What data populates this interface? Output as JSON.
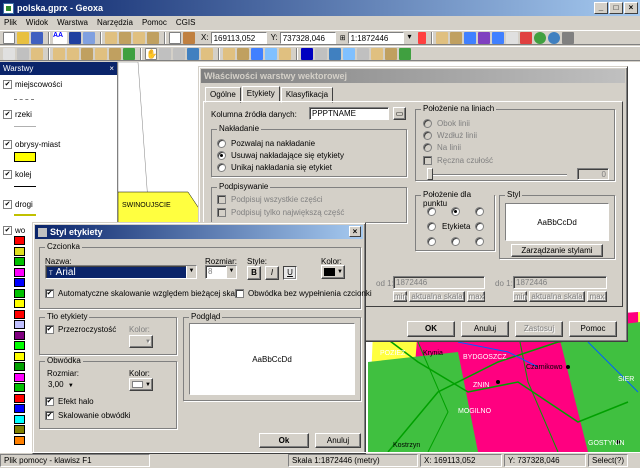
{
  "window": {
    "title": "polska.gprx - Geoxa"
  },
  "menu": [
    "Plik",
    "Widok",
    "Warstwa",
    "Narzędzia",
    "Pomoc",
    "CGIS"
  ],
  "toolbar": {
    "x_label": "X:",
    "x_value": "169113,052",
    "y_label": "Y:",
    "y_value": "737328,046",
    "scale_value": "1:1872446"
  },
  "layers_panel": {
    "title": "Warstwy",
    "layers": [
      {
        "name": "miejscowości",
        "checked": true
      },
      {
        "name": "rzeki",
        "checked": true
      },
      {
        "name": "obrysy-miast",
        "checked": true
      },
      {
        "name": "kolej",
        "checked": true
      },
      {
        "name": "drogi",
        "checked": true
      },
      {
        "name": "wo",
        "checked": true
      }
    ],
    "palette": [
      "#ff0000",
      "#e0e020",
      "#00c000",
      "#ff00ff",
      "#0000ff",
      "#00c000",
      "#ffff00",
      "#ff0000",
      "#c0c0ff",
      "#800080",
      "#00ff00",
      "#ffff00",
      "#00a000",
      "#ff00ff",
      "#00c000",
      "#ff0000",
      "#0000ff",
      "#00ffff",
      "#808000",
      "#ff8000"
    ]
  },
  "map": {
    "labels": {
      "swinoujscie": "SWINOUJSCIE",
      "pozl": "POZIEZ",
      "krynia": "Krynia",
      "bydgoszcz": "BYDGOSZCZ",
      "czarnikowo": "Czarnikowo",
      "znin": "ZNIN",
      "mogilno": "MOGILNO",
      "gostynin": "GOSTYNIN",
      "kostrzyn": "Kostrzyn",
      "sier": "SIER"
    },
    "colors": {
      "region": "#ff0080",
      "land": "#ffff40",
      "green": "#40c040",
      "water": "#00a0ff"
    }
  },
  "props_dialog": {
    "title": "Właściwości warstwy wektorowej",
    "tabs": [
      "Ogólne",
      "Etykiety",
      "Klasyfikacja"
    ],
    "source_column_label": "Kolumna źródła danych:",
    "source_column_value": "PPPTNAME",
    "overlap": {
      "title": "Nakładanie",
      "options": [
        "Pozwalaj na nakładanie",
        "Usuwaj nakładające się etykiety",
        "Unikaj nakładania się etykiet"
      ],
      "selected": 1
    },
    "signing": {
      "title": "Podpisywanie",
      "options": [
        "Podpisuj wszystkie części",
        "Podpisuj tylko największą część"
      ]
    },
    "line_position": {
      "title": "Położenie na liniach",
      "options": [
        "Obok linii",
        "Wzdłuż linii",
        "Na linii"
      ],
      "follow": "Ręczna czułość",
      "slider_value": "0"
    },
    "point_position": {
      "title": "Położenie dla punktu",
      "center_label": "Etykieta"
    },
    "style": {
      "title": "Styl",
      "preview": "AaBbCcDd",
      "manage_button": "Zarządzanie stylami"
    },
    "scale_left": {
      "label": "od 1:",
      "value": "1872446",
      "buttons": [
        "min",
        "aktualna skala",
        "max"
      ]
    },
    "scale_right": {
      "label": "do 1:",
      "value": "1872446",
      "buttons": [
        "min",
        "aktualna skala",
        "max"
      ]
    },
    "buttons": {
      "ok": "OK",
      "cancel": "Anuluj",
      "apply": "Zastosuj",
      "help": "Pomoc"
    }
  },
  "style_dialog": {
    "title": "Styl etykiety",
    "font_group": "Czcionka",
    "name_label": "Nazwa:",
    "font_name": "Arial",
    "size_label": "Rozmiar:",
    "size_value": "8",
    "style_label": "Style:",
    "style_buttons": [
      "B",
      "I",
      "U"
    ],
    "color_label": "Kolor:",
    "color_value": "#000000",
    "auto_scale": "Automatyczne skalowanie względem bieżącej skali",
    "outline_no_fill": "Obwódka bez wypełnienia czcionki",
    "bg_group": "Tło etykiety",
    "transparency": "Przezroczystość",
    "bg_color_label": "Kolor:",
    "preview_group": "Podgląd",
    "preview_text": "AaBbCcDd",
    "outline_group": "Obwódka",
    "outline_size_label": "Rozmiar:",
    "outline_size_value": "3,00",
    "outline_color_label": "Kolor:",
    "halo": "Efekt halo",
    "scale_outline": "Skalowanie obwódki",
    "ok": "Ok",
    "cancel": "Anuluj"
  },
  "status": {
    "help": "Plik pomocy - klawisz F1",
    "scale": "Skala 1:1872446 (metry)",
    "x": "X: 169113,052",
    "y": "Y: 737328,046",
    "select": "Select(?)"
  }
}
